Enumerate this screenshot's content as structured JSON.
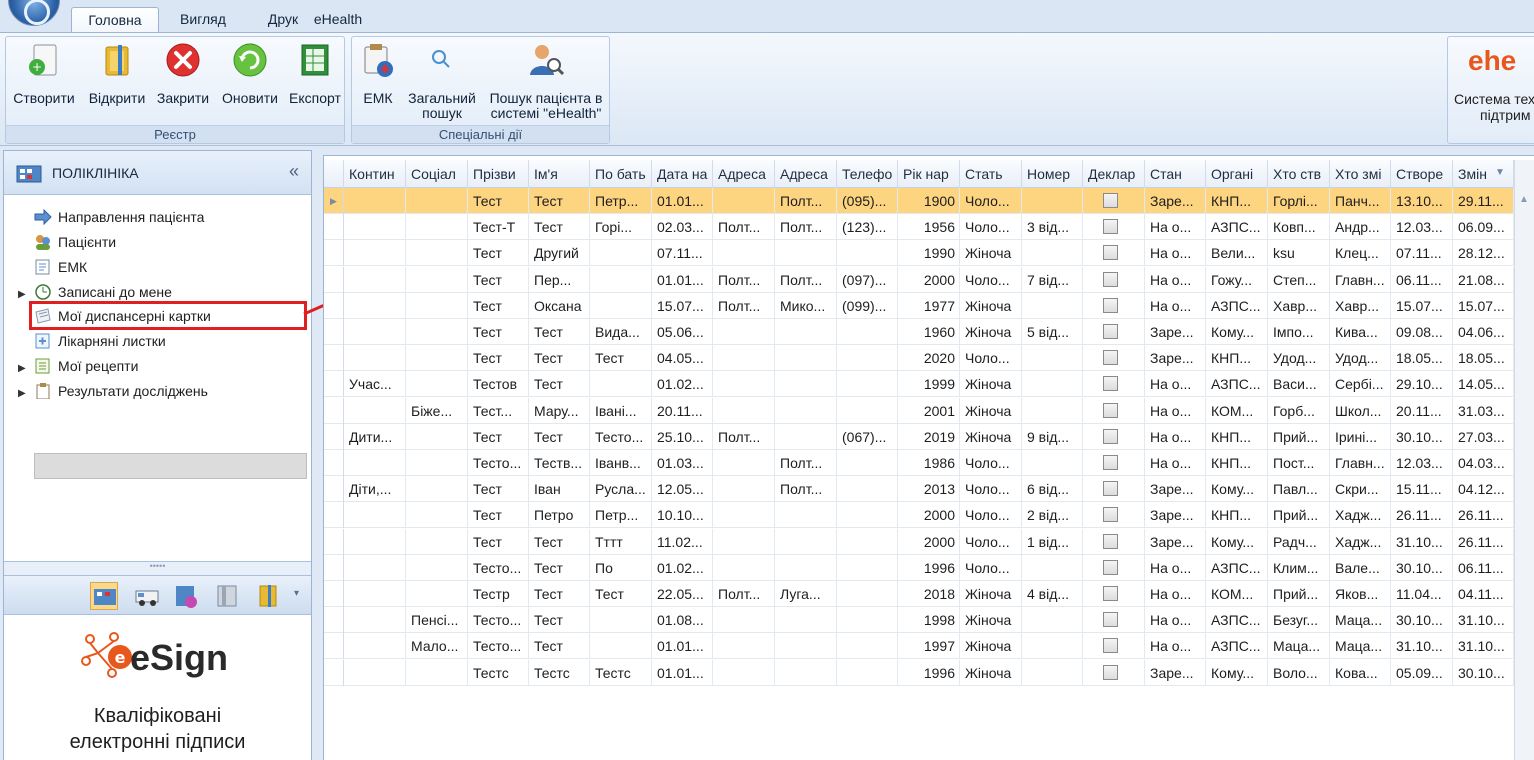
{
  "ribbon": {
    "tabs": [
      "Головна",
      "Вигляд",
      "Друк",
      "eHealth"
    ],
    "groups": {
      "registry": {
        "label": "Реєстр",
        "buttons": [
          "Створити",
          "Відкрити",
          "Закрити",
          "Оновити",
          "Експорт"
        ]
      },
      "special": {
        "label": "Спеціальні дії",
        "buttons": [
          "ЕМК",
          "Загальний пошук",
          "Пошук пацієнта в системі \"eHealth\""
        ]
      }
    },
    "ehealth": {
      "logo": "ehe",
      "text_line1": "Система тех",
      "text_line2": "підтрим"
    }
  },
  "left_panel": {
    "title": "ПОЛІКЛІНІКА",
    "collapse": "«",
    "nav_items": [
      "Направлення пацієнта",
      "Пацієнти",
      "ЕМК",
      "Записані до мене",
      "Мої диспансерні картки",
      "Лікарняні листки",
      "Мої рецепти",
      "Результати досліджень"
    ],
    "splitter_dots": "•••••",
    "esign": {
      "brand": "eSign",
      "line1": "Кваліфіковані",
      "line2": "електронні підписи"
    }
  },
  "grid": {
    "columns": [
      "Контин",
      "Соціал",
      "Прізви",
      "Ім'я",
      "По бать",
      "Дата на",
      "Адреса",
      "Адреса",
      "Телефо",
      "Рік нар",
      "Стать",
      "Номер",
      "Деклар",
      "Стан",
      "Органі",
      "Хто ств",
      "Хто змі",
      "Створе",
      "Змін"
    ],
    "rows": [
      [
        "",
        "",
        "Тест",
        "Тест",
        "Петр...",
        "01.01...",
        "",
        "Полт...",
        "(095)...",
        "1900",
        "Чоло...",
        "",
        false,
        "Заре...",
        "КНП...",
        "Горлі...",
        "Панч...",
        "13.10...",
        "29.11..."
      ],
      [
        "",
        "",
        "Тест-Т",
        "Тест",
        "Горі...",
        "02.03...",
        "Полт...",
        "Полт...",
        "(123)...",
        "1956",
        "Чоло...",
        "3 від...",
        false,
        "На о...",
        "АЗПС...",
        "Ковп...",
        "Андр...",
        "12.03...",
        "06.09..."
      ],
      [
        "",
        "",
        "Тест",
        "Другий",
        "",
        "07.11...",
        "",
        "",
        "",
        "1990",
        "Жіноча",
        "",
        false,
        "На о...",
        "Вели...",
        "ksu",
        "Клец...",
        "07.11...",
        "28.12..."
      ],
      [
        "",
        "",
        "Тест",
        "Пер...",
        "",
        "01.01...",
        "Полт...",
        "Полт...",
        "(097)...",
        "2000",
        "Чоло...",
        "7 від...",
        false,
        "На о...",
        "Гожу...",
        "Степ...",
        "Главн...",
        "06.11...",
        "21.08..."
      ],
      [
        "",
        "",
        "Тест",
        "Оксана",
        "",
        "15.07...",
        "Полт...",
        "Мико...",
        "(099)...",
        "1977",
        "Жіноча",
        "",
        false,
        "На о...",
        "АЗПС...",
        "Хавр...",
        "Хавр...",
        "15.07...",
        "15.07..."
      ],
      [
        "",
        "",
        "Тест",
        "Тест",
        "Вида...",
        "05.06...",
        "",
        "",
        "",
        "1960",
        "Жіноча",
        "5 від...",
        false,
        "Заре...",
        "Кому...",
        "Імпо...",
        "Кива...",
        "09.08...",
        "04.06..."
      ],
      [
        "",
        "",
        "Тест",
        "Тест",
        "Тест",
        "04.05...",
        "",
        "",
        "",
        "2020",
        "Чоло...",
        "",
        false,
        "Заре...",
        "КНП...",
        "Удод...",
        "Удод...",
        "18.05...",
        "18.05..."
      ],
      [
        "Учас...",
        "",
        "Тестов",
        "Тест",
        "",
        "01.02...",
        "",
        "",
        "",
        "1999",
        "Жіноча",
        "",
        false,
        "На о...",
        "АЗПС...",
        "Васи...",
        "Сербі...",
        "29.10...",
        "14.05..."
      ],
      [
        "",
        "Біже...",
        "Тест...",
        "Мару...",
        "Івані...",
        "20.11...",
        "",
        "",
        "",
        "2001",
        "Жіноча",
        "",
        false,
        "На о...",
        "КОМ...",
        "Горб...",
        "Школ...",
        "20.11...",
        "31.03..."
      ],
      [
        "Дити...",
        "",
        "Тест",
        "Тест",
        "Тесто...",
        "25.10...",
        "Полт...",
        "",
        "(067)...",
        "2019",
        "Жіноча",
        "9 від...",
        false,
        "На о...",
        "КНП...",
        "Прий...",
        "Ірині...",
        "30.10...",
        "27.03..."
      ],
      [
        "",
        "",
        "Тесто...",
        "Теств...",
        "Іванв...",
        "01.03...",
        "",
        "Полт...",
        "",
        "1986",
        "Чоло...",
        "",
        false,
        "На о...",
        "КНП...",
        "Пост...",
        "Главн...",
        "12.03...",
        "04.03..."
      ],
      [
        "Діти,...",
        "",
        "Тест",
        "Іван",
        "Русла...",
        "12.05...",
        "",
        "Полт...",
        "",
        "2013",
        "Чоло...",
        "6 від...",
        false,
        "Заре...",
        "Кому...",
        "Павл...",
        "Скри...",
        "15.11...",
        "04.12..."
      ],
      [
        "",
        "",
        "Тест",
        "Петро",
        "Петр...",
        "10.10...",
        "",
        "",
        "",
        "2000",
        "Чоло...",
        "2 від...",
        false,
        "Заре...",
        "КНП...",
        "Прий...",
        "Хадж...",
        "26.11...",
        "26.11..."
      ],
      [
        "",
        "",
        "Тест",
        "Тест",
        "Тттт",
        "11.02...",
        "",
        "",
        "",
        "2000",
        "Чоло...",
        "1 від...",
        false,
        "Заре...",
        "Кому...",
        "Радч...",
        "Хадж...",
        "31.10...",
        "26.11..."
      ],
      [
        "",
        "",
        "Тесто...",
        "Тест",
        "По",
        "01.02...",
        "",
        "",
        "",
        "1996",
        "Чоло...",
        "",
        false,
        "На о...",
        "АЗПС...",
        "Клим...",
        "Вале...",
        "30.10...",
        "06.11..."
      ],
      [
        "",
        "",
        "Тестр",
        "Тест",
        "Тест",
        "22.05...",
        "Полт...",
        "Луга...",
        "",
        "2018",
        "Жіноча",
        "4 від...",
        false,
        "На о...",
        "КОМ...",
        "Прий...",
        "Яков...",
        "11.04...",
        "04.11..."
      ],
      [
        "",
        "Пенсі...",
        "Тесто...",
        "Тест",
        "",
        "01.08...",
        "",
        "",
        "",
        "1998",
        "Жіноча",
        "",
        false,
        "На о...",
        "АЗПС...",
        "Безуг...",
        "Маца...",
        "30.10...",
        "31.10..."
      ],
      [
        "",
        "Мало...",
        "Тесто...",
        "Тест",
        "",
        "01.01...",
        "",
        "",
        "",
        "1997",
        "Жіноча",
        "",
        false,
        "На о...",
        "АЗПС...",
        "Маца...",
        "Маца...",
        "31.10...",
        "31.10..."
      ],
      [
        "",
        "",
        "Тестс",
        "Тестс",
        "Тестс",
        "01.01...",
        "",
        "",
        "",
        "1996",
        "Жіноча",
        "",
        false,
        "Заре...",
        "Кому...",
        "Воло...",
        "Кова...",
        "05.09...",
        "30.10..."
      ]
    ],
    "selected_row": 0
  }
}
